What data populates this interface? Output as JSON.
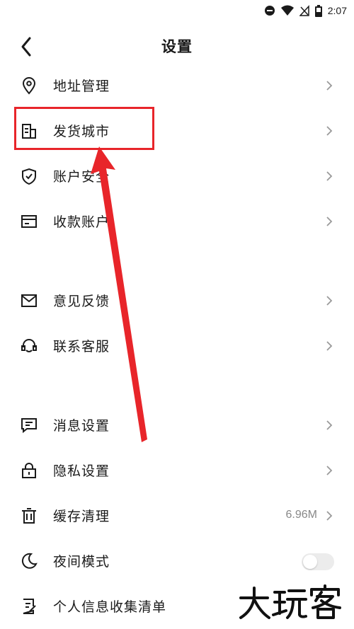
{
  "status": {
    "time": "2:07"
  },
  "header": {
    "title": "设置"
  },
  "sections": [
    {
      "rows": [
        {
          "label": "地址管理",
          "icon": "location-pin-icon"
        },
        {
          "label": "发货城市",
          "icon": "building-icon"
        },
        {
          "label": "账户安全",
          "icon": "shield-check-icon"
        },
        {
          "label": "收款账户",
          "icon": "card-icon"
        }
      ]
    },
    {
      "rows": [
        {
          "label": "意见反馈",
          "icon": "mail-icon"
        },
        {
          "label": "联系客服",
          "icon": "headset-icon"
        }
      ]
    },
    {
      "rows": [
        {
          "label": "消息设置",
          "icon": "message-icon"
        },
        {
          "label": "隐私设置",
          "icon": "lock-icon"
        },
        {
          "label": "缓存清理",
          "icon": "trash-icon",
          "value": "6.96M"
        },
        {
          "label": "夜间模式",
          "icon": "moon-icon",
          "toggle": false
        },
        {
          "label": "个人信息收集清单",
          "icon": "document-icon"
        }
      ]
    }
  ],
  "annotation": {
    "highlight_color": "#e8252a"
  },
  "watermark": {
    "text": "大玩客"
  }
}
